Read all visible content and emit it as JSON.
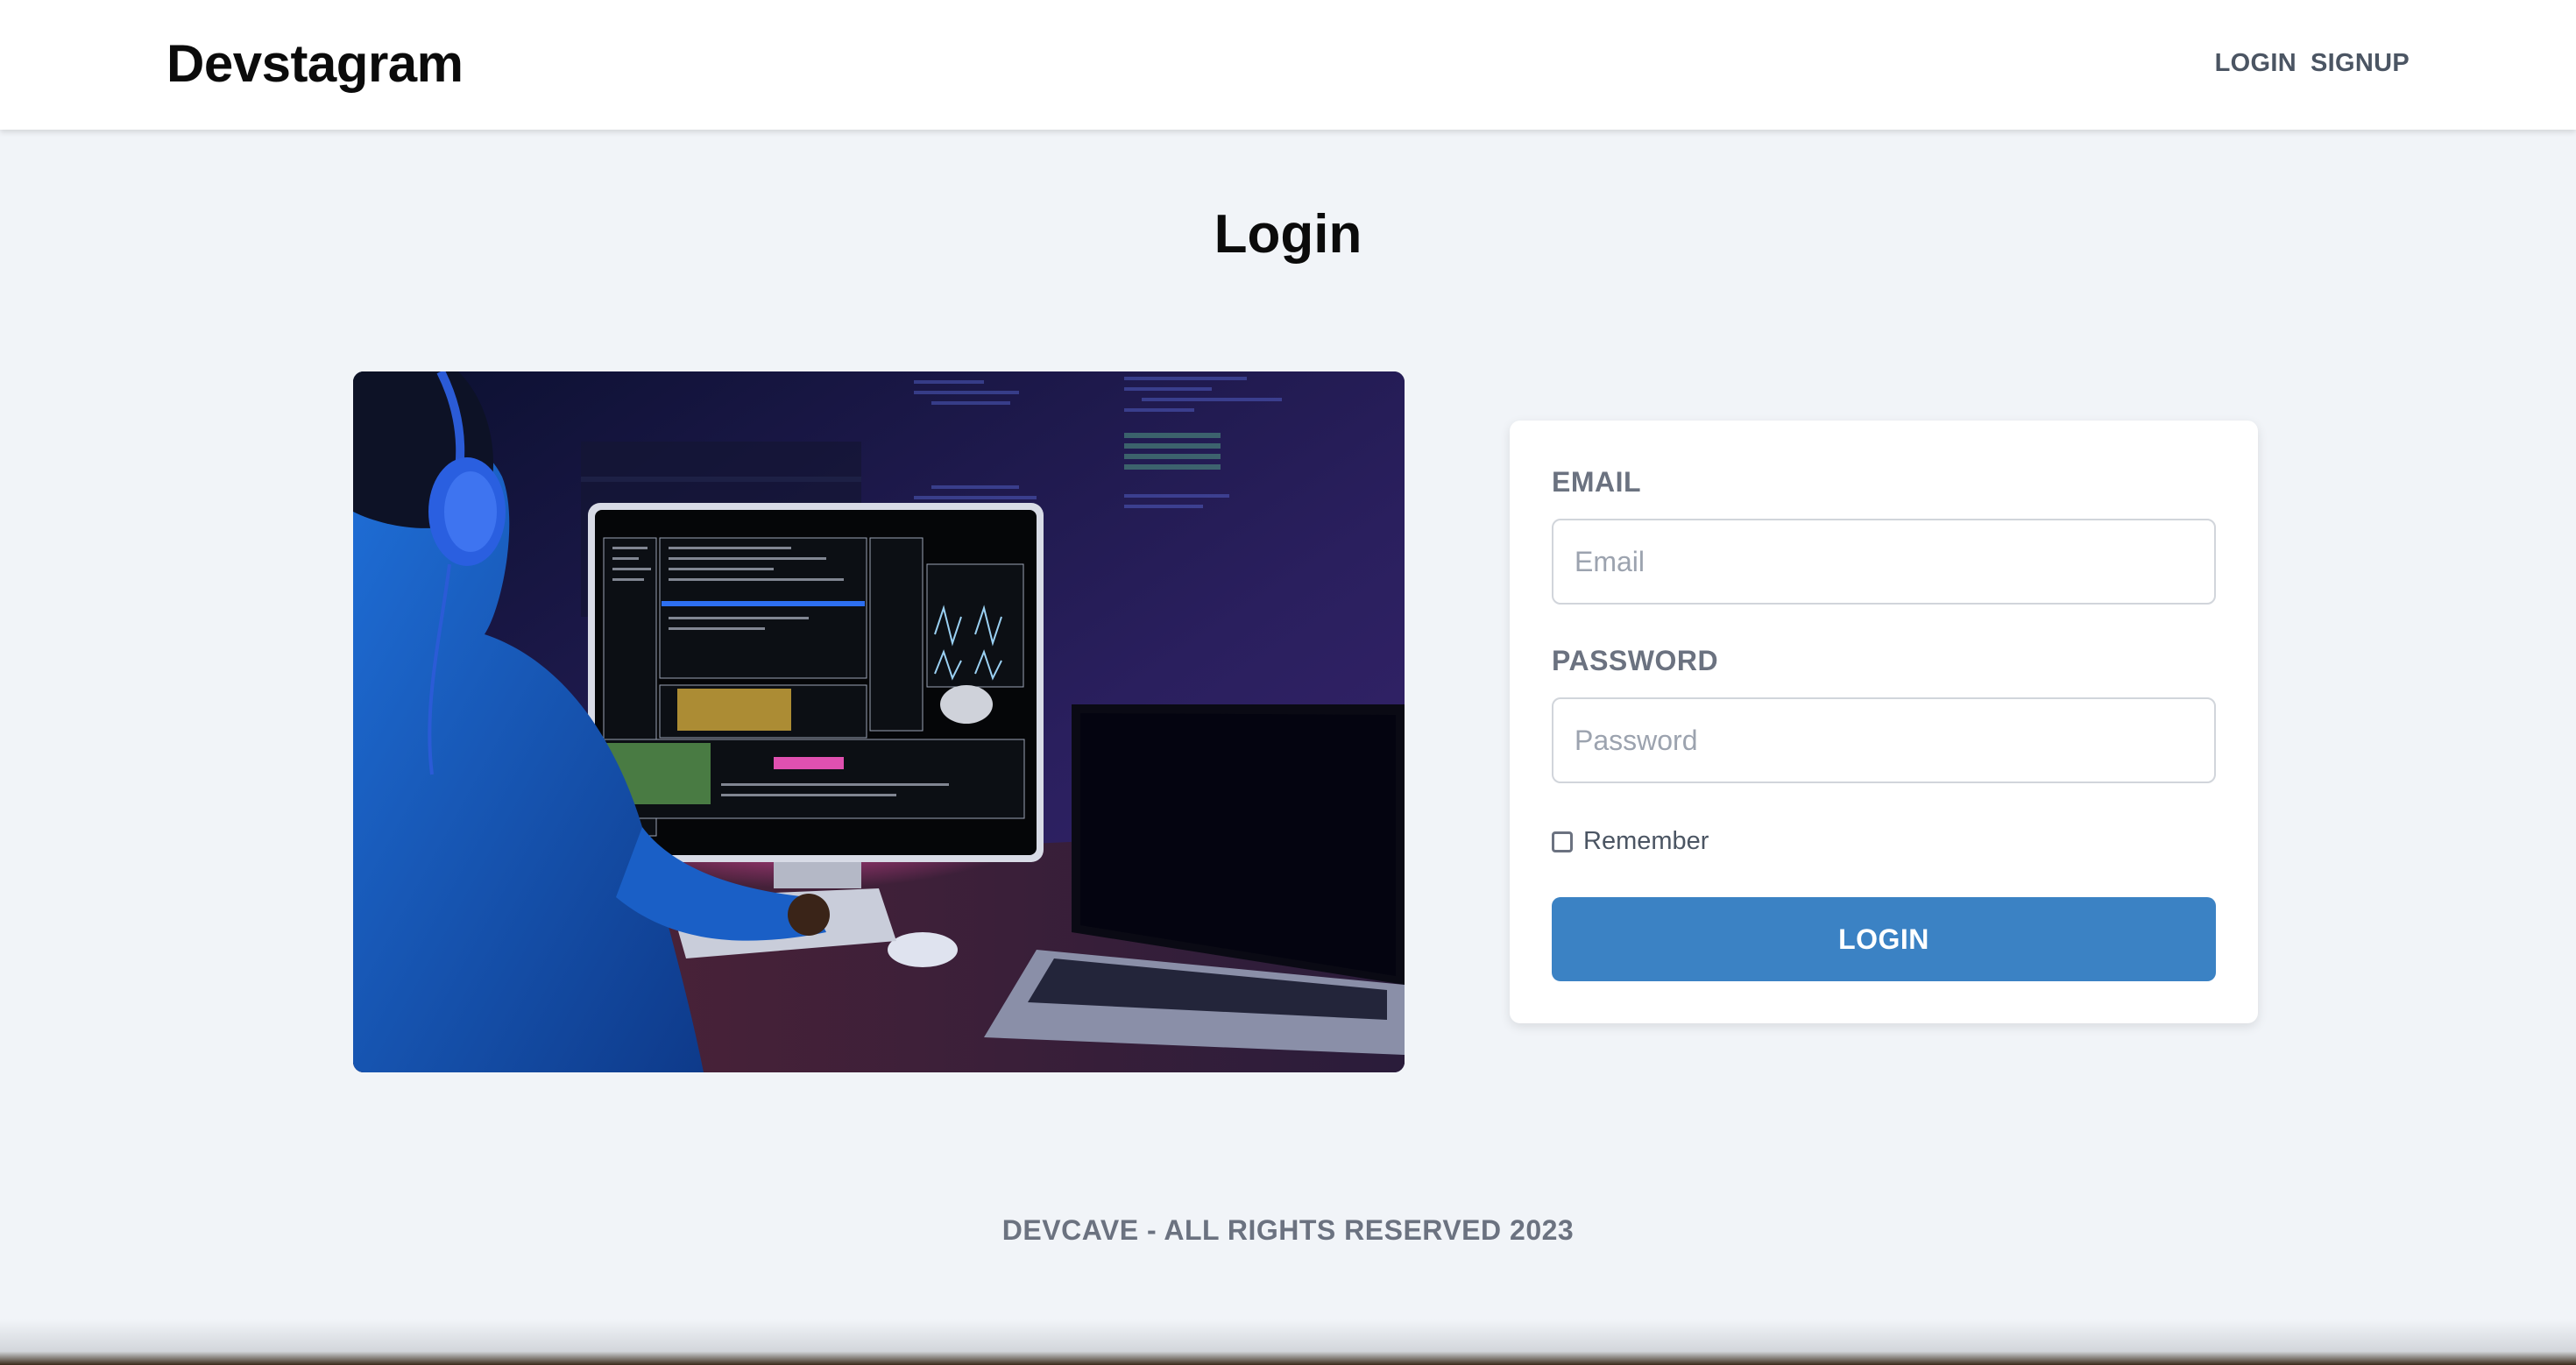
{
  "header": {
    "brand": "Devstagram",
    "nav": {
      "login": "LOGIN",
      "signup": "SIGNUP"
    }
  },
  "main": {
    "title": "Login"
  },
  "form": {
    "email_label": "EMAIL",
    "email_placeholder": "Email",
    "password_label": "PASSWORD",
    "password_placeholder": "Password",
    "remember_label": "Remember",
    "remember_checked": false,
    "submit_label": "LOGIN"
  },
  "footer": {
    "text": "DEVCAVE - ALL RIGHTS RESERVED 2023"
  },
  "colors": {
    "background": "#f1f4f8",
    "primary_button": "#3b82c4",
    "label_gray": "#6b7280"
  }
}
